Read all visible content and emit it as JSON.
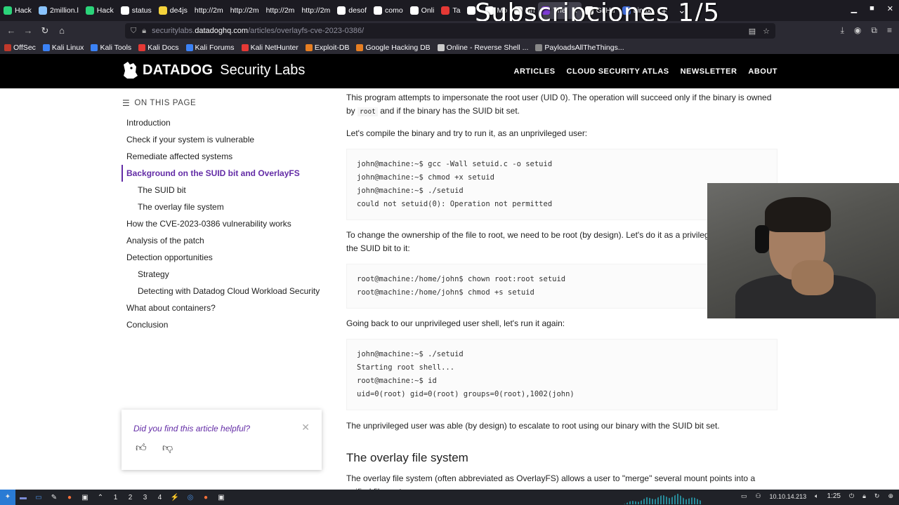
{
  "overlay_text": "Subscripciones 1/5",
  "tabs": [
    {
      "title": "Hack",
      "color": "#2bd47a",
      "active": false
    },
    {
      "title": "2million.l",
      "color": "#8ac4ff",
      "active": false
    },
    {
      "title": "Hack",
      "color": "#2bd47a",
      "active": false
    },
    {
      "title": "status",
      "color": "#ffffff",
      "active": false
    },
    {
      "title": "de4js",
      "color": "#f5d33b",
      "active": false
    },
    {
      "title": "http://2m",
      "color": "",
      "active": false
    },
    {
      "title": "http://2m",
      "color": "",
      "active": false
    },
    {
      "title": "http://2m",
      "color": "",
      "active": false
    },
    {
      "title": "http://2m",
      "color": "",
      "active": false
    },
    {
      "title": "desof",
      "color": "#ffffff",
      "active": false
    },
    {
      "title": "como",
      "color": "#ffffff",
      "active": false
    },
    {
      "title": "Onli",
      "color": "#ffffff",
      "active": false
    },
    {
      "title": "Ta",
      "color": "#e53935",
      "active": false
    },
    {
      "title": "",
      "color": "#ffffff",
      "active": false
    },
    {
      "title": "Mo",
      "color": "#ffffff",
      "active": false
    },
    {
      "title": "Nh",
      "color": "#ffffff",
      "active": false
    },
    {
      "title": "The",
      "color": "#7e3ad6",
      "active": true
    },
    {
      "title": "GitHu",
      "color": "#ffffff",
      "active": false
    },
    {
      "title": "Linux",
      "color": "#3f6bd8",
      "active": false
    }
  ],
  "url": {
    "prefix": "securitylabs.",
    "host": "datadoghq.com",
    "path": "/articles/overlayfs-cve-2023-0386/"
  },
  "bookmarks": [
    {
      "label": "OffSec",
      "color": "#c0392b"
    },
    {
      "label": "Kali Linux",
      "color": "#3b82f6"
    },
    {
      "label": "Kali Tools",
      "color": "#3b82f6"
    },
    {
      "label": "Kali Docs",
      "color": "#e53935"
    },
    {
      "label": "Kali Forums",
      "color": "#3b82f6"
    },
    {
      "label": "Kali NetHunter",
      "color": "#e53935"
    },
    {
      "label": "Exploit-DB",
      "color": "#e67e22"
    },
    {
      "label": "Google Hacking DB",
      "color": "#e67e22"
    },
    {
      "label": "Online - Reverse Shell ...",
      "color": "#cccccc"
    },
    {
      "label": "PayloadsAllTheThings...",
      "color": "#888888"
    }
  ],
  "site": {
    "brand": "DATADOG",
    "sub": "Security Labs",
    "nav": [
      "ARTICLES",
      "CLOUD SECURITY ATLAS",
      "NEWSLETTER",
      "ABOUT"
    ]
  },
  "toc": {
    "heading": "ON THIS PAGE",
    "items": [
      {
        "label": "Introduction",
        "level": 1,
        "active": false
      },
      {
        "label": "Check if your system is vulnerable",
        "level": 1,
        "active": false
      },
      {
        "label": "Remediate affected systems",
        "level": 1,
        "active": false
      },
      {
        "label": "Background on the SUID bit and OverlayFS",
        "level": 1,
        "active": true
      },
      {
        "label": "The SUID bit",
        "level": 2,
        "active": false
      },
      {
        "label": "The overlay file system",
        "level": 2,
        "active": false
      },
      {
        "label": "How the CVE-2023-0386 vulnerability works",
        "level": 1,
        "active": false
      },
      {
        "label": "Analysis of the patch",
        "level": 1,
        "active": false
      },
      {
        "label": "Detection opportunities",
        "level": 1,
        "active": false
      },
      {
        "label": "Strategy",
        "level": 2,
        "active": false
      },
      {
        "label": "Detecting with Datadog Cloud Workload Security",
        "level": 2,
        "active": false
      },
      {
        "label": "What about containers?",
        "level": 1,
        "active": false
      },
      {
        "label": "Conclusion",
        "level": 1,
        "active": false
      }
    ]
  },
  "feedback": {
    "question": "Did you find this article helpful?"
  },
  "article": {
    "p1_a": "This program attempts to impersonate the root user (UID 0). The operation will succeed only if the binary is owned by ",
    "p1_code": "root",
    "p1_b": " and if the binary has the SUID bit set.",
    "p2": "Let's compile the binary and try to run it, as an unprivileged user:",
    "code1": "john@machine:~$ gcc -Wall setuid.c -o setuid\njohn@machine:~$ chmod +x setuid\njohn@machine:~$ ./setuid\ncould not setuid(0): Operation not permitted",
    "p3": "To change the ownership of the file to root, we need to be root (by design). Let's do it as a privileged user and add the SUID bit to it:",
    "code2": "root@machine:/home/john$ chown root:root setuid\nroot@machine:/home/john$ chmod +s setuid",
    "p4": "Going back to our unprivileged user shell, let's run it again:",
    "code3": "john@machine:~$ ./setuid\nStarting root shell...\nroot@machine:~$ id\nuid=0(root) gid=0(root) groups=0(root),1002(john)",
    "p5": "The unprivileged user was able (by design) to escalate to root using our binary with the SUID bit set.",
    "h2": "The overlay file system",
    "p6": "The overlay file system (often abbreviated as OverlayFS) allows a user to \"merge\" several mount points into a unified file system."
  },
  "taskbar": {
    "workspaces": [
      "1",
      "2",
      "3",
      "4"
    ],
    "ip": "10.10.14.213",
    "time": "1:25"
  }
}
